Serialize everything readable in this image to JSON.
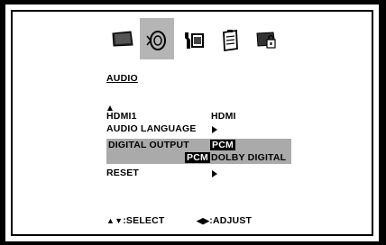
{
  "menu_tabs": [
    {
      "name": "picture",
      "icon": "monitor-icon",
      "selected": false
    },
    {
      "name": "audio",
      "icon": "audio-icon",
      "selected": true
    },
    {
      "name": "setup",
      "icon": "setup-icon",
      "selected": false
    },
    {
      "name": "options",
      "icon": "clipboard-icon",
      "selected": false
    },
    {
      "name": "lock",
      "icon": "lock-icon",
      "selected": false
    }
  ],
  "section_title": "AUDIO",
  "rows": {
    "hdmi_label": "HDMI1",
    "hdmi_value": "HDMI",
    "language_label": "AUDIO LANGUAGE",
    "digital_label": "DIGITAL OUTPUT",
    "digital_selected": "PCM",
    "option_pcm": "PCM",
    "option_dolby": "DOLBY DIGITAL",
    "reset_label": "RESET"
  },
  "footer": {
    "select_hint": ":SELECT",
    "adjust_hint": ":ADJUST"
  },
  "colors": {
    "highlight": "#aaaaaa",
    "selected_tab": "#b5b5b5"
  }
}
